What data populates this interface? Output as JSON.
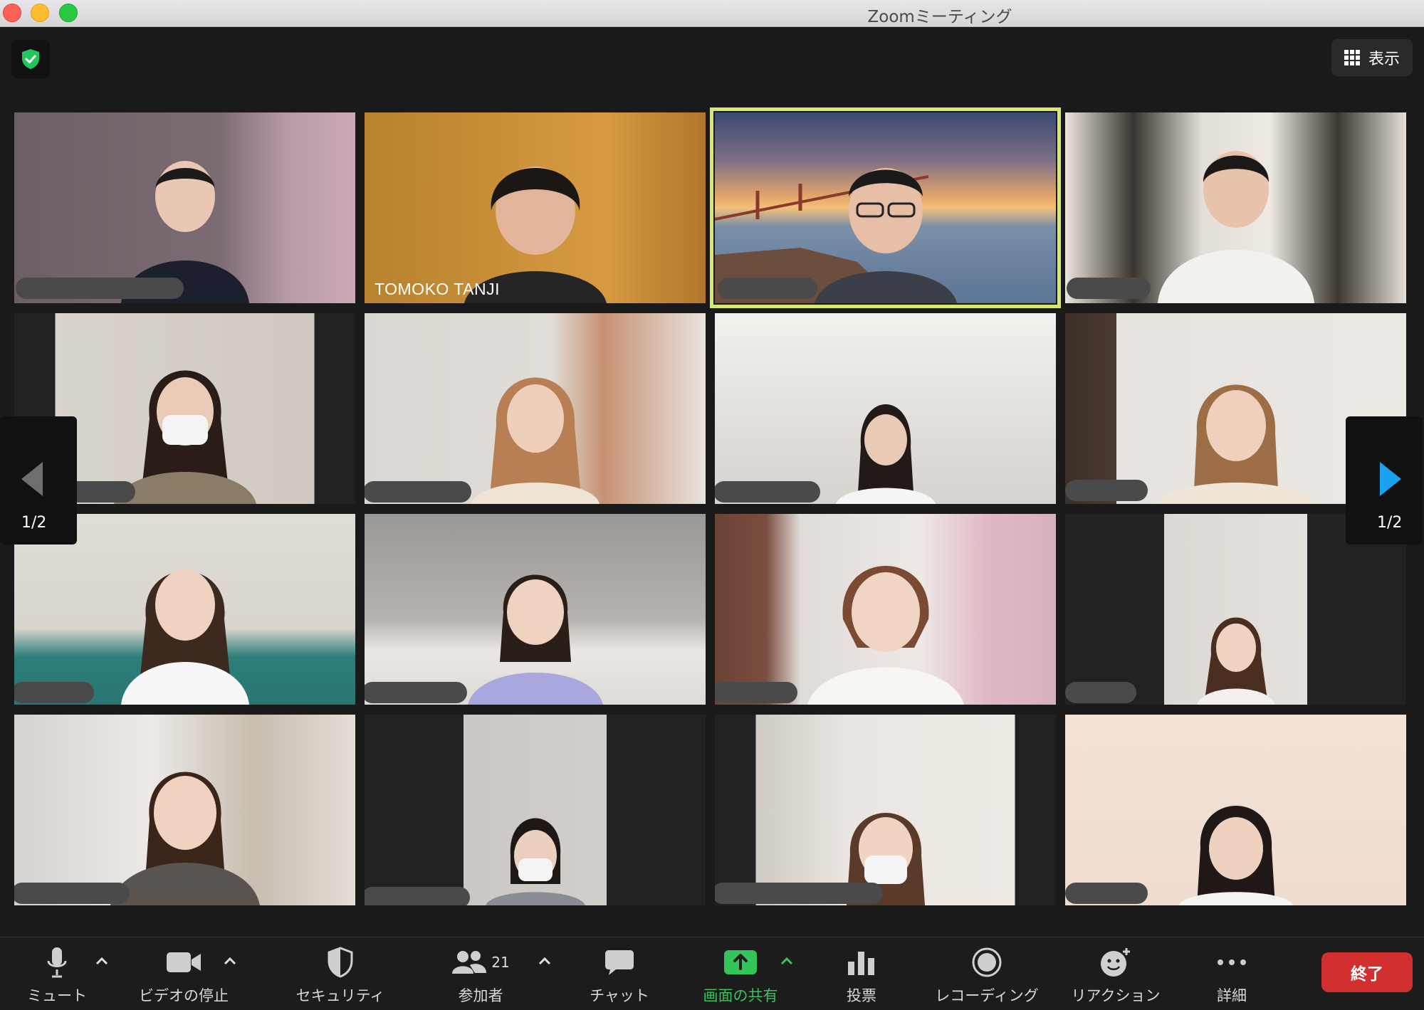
{
  "window": {
    "title": "Zoomミーティング"
  },
  "top": {
    "view_label": "表示"
  },
  "pager": {
    "left_page": "1/2",
    "right_page": "1/2"
  },
  "tiles": [
    {
      "name_label": ""
    },
    {
      "name_label": "TOMOKO TANJI"
    }
  ],
  "toolbar": {
    "mute_label": "ミュート",
    "video_label": "ビデオの停止",
    "security_label": "セキュリティ",
    "participants_label": "参加者",
    "participants_count": "21",
    "chat_label": "チャット",
    "share_label": "画面の共有",
    "poll_label": "投票",
    "record_label": "レコーディング",
    "reaction_label": "リアクション",
    "more_label": "詳細",
    "end_label": "終了"
  },
  "colors": {
    "share_green": "#35c45a",
    "end_red": "#d2302e",
    "active_border": "#d8e86c",
    "pager_arrow": "#1aa1f2"
  }
}
